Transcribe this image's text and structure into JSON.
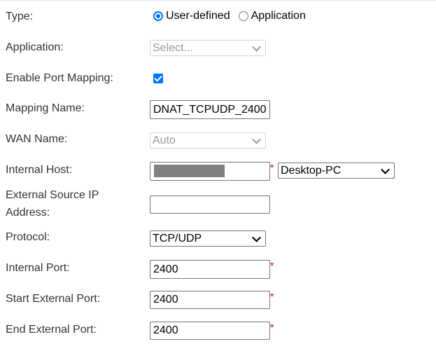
{
  "form": {
    "type": {
      "label": "Type:",
      "options": [
        "User-defined",
        "Application"
      ],
      "selected": "User-defined"
    },
    "application": {
      "label": "Application:",
      "placeholder": "Select..."
    },
    "enable_port_mapping": {
      "label": "Enable Port Mapping:",
      "checked": true
    },
    "mapping_name": {
      "label": "Mapping Name:",
      "value": "DNAT_TCPUDP_2400"
    },
    "wan_name": {
      "label": "WAN Name:",
      "value": "Auto"
    },
    "internal_host": {
      "label": "Internal Host:",
      "device": "Desktop-PC"
    },
    "external_source_ip": {
      "label": "External Source IP Address:",
      "value": ""
    },
    "protocol": {
      "label": "Protocol:",
      "value": "TCP/UDP"
    },
    "internal_port": {
      "label": "Internal Port:",
      "value": "2400"
    },
    "start_external_port": {
      "label": "Start External Port:",
      "value": "2400"
    },
    "end_external_port": {
      "label": "End External Port:",
      "value": "2400"
    },
    "required_mark": "*"
  },
  "colors": {
    "accent": "#0075ff",
    "required": "#e00000",
    "redaction": "#808080"
  }
}
